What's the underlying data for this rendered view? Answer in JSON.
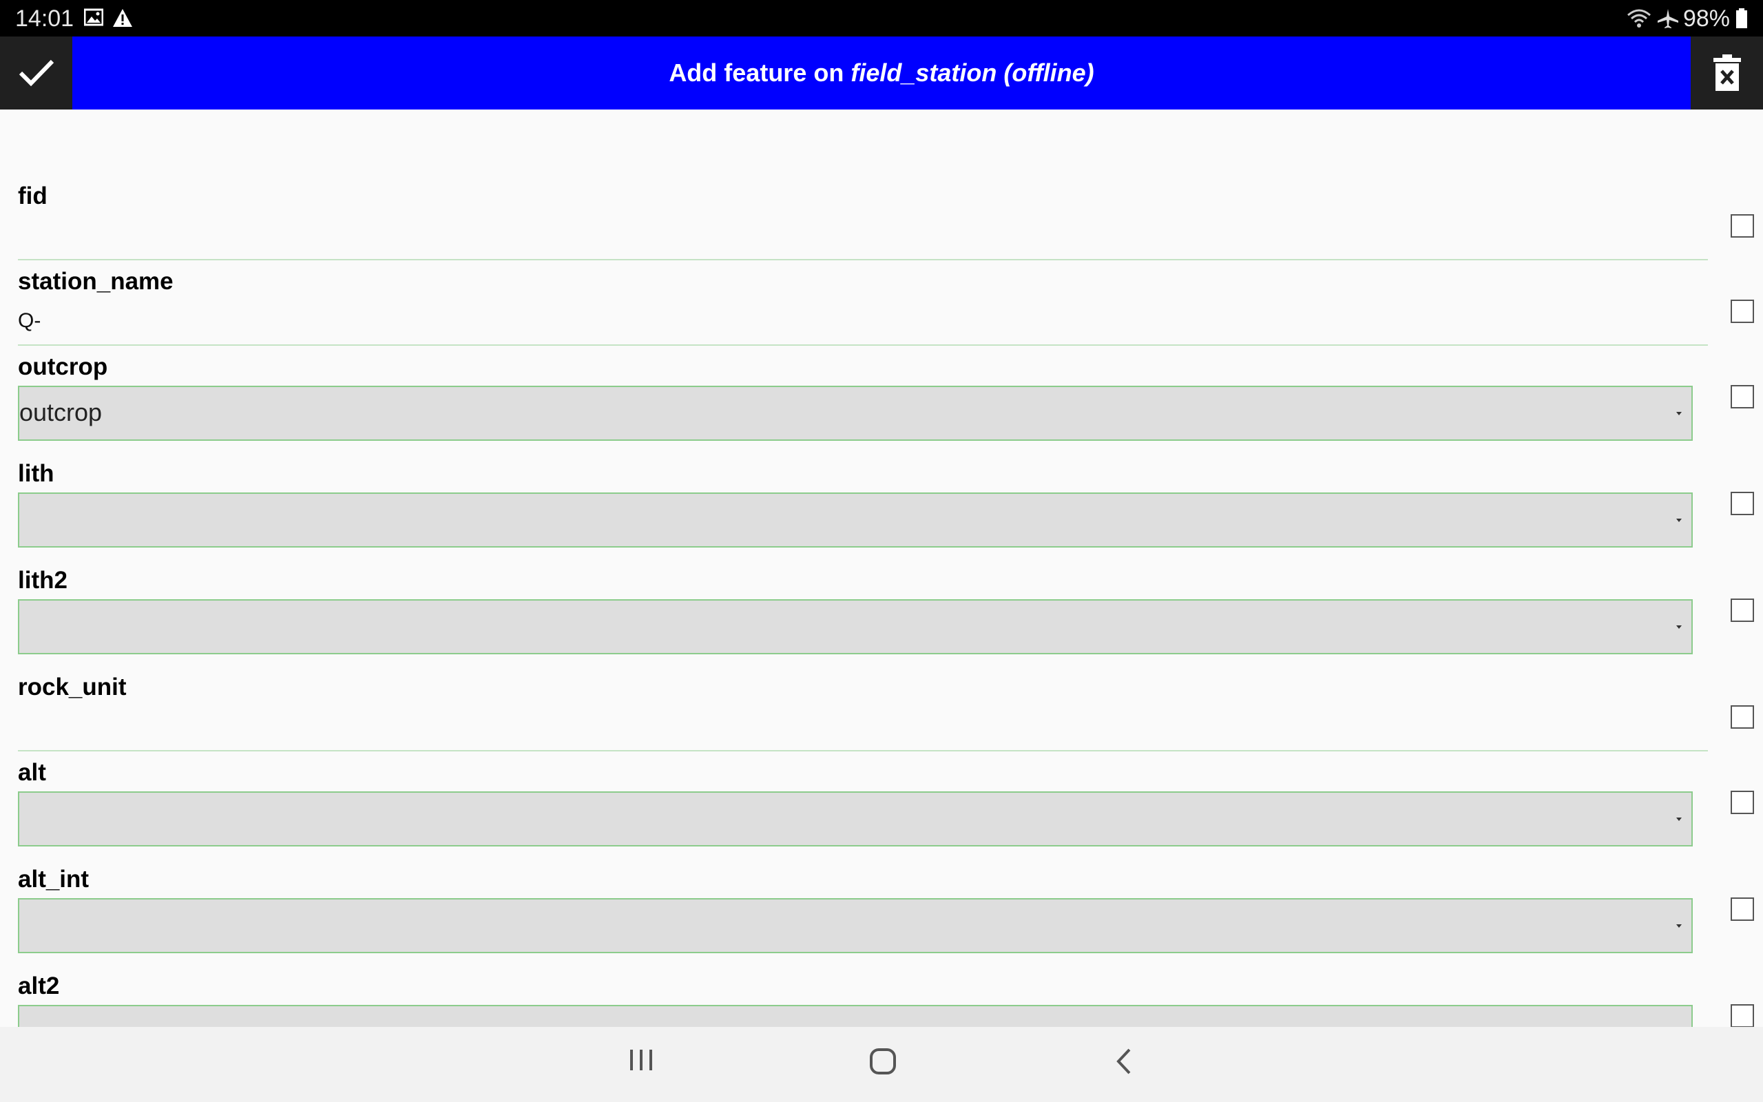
{
  "status_bar": {
    "time": "14:01",
    "battery": "98%",
    "icons": [
      "gallery-icon",
      "warning-icon",
      "wifi-icon",
      "airplane-icon",
      "battery-icon"
    ]
  },
  "title_bar": {
    "prefix": "Add feature on",
    "layer_name": "field_station (offline)",
    "accent_color": "#0000ff"
  },
  "fields": [
    {
      "label": "fid",
      "type": "text",
      "value": ""
    },
    {
      "label": "station_name",
      "type": "text",
      "value": "Q-"
    },
    {
      "label": "outcrop",
      "type": "combo",
      "value": "outcrop"
    },
    {
      "label": "lith",
      "type": "combo",
      "value": ""
    },
    {
      "label": "lith2",
      "type": "combo",
      "value": ""
    },
    {
      "label": "rock_unit",
      "type": "text",
      "value": ""
    },
    {
      "label": "alt",
      "type": "combo",
      "value": ""
    },
    {
      "label": "alt_int",
      "type": "combo",
      "value": ""
    },
    {
      "label": "alt2",
      "type": "combo",
      "value": ""
    }
  ]
}
